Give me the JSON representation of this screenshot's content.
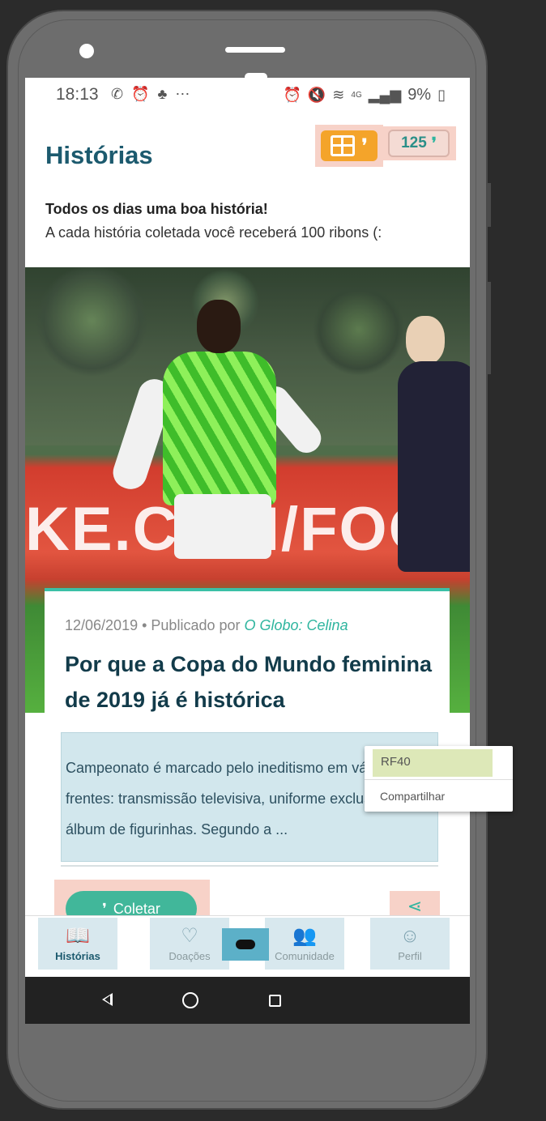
{
  "status_bar": {
    "time": "18:13",
    "left_icons": [
      "whatsapp-icon",
      "alarm-icon",
      "notification-icon",
      "more-icon"
    ],
    "right_icons": [
      "alarm-icon",
      "mute-icon",
      "wifi-icon",
      "signal-icon"
    ],
    "network": "4G",
    "battery": "9%"
  },
  "header": {
    "title": "Histórias",
    "ribbons_count": "125"
  },
  "intro": {
    "headline": "Todos os dias uma boa história!",
    "description": "A cada história coletada você receberá 100 ribons (:"
  },
  "story": {
    "date": "12/06/2019",
    "published_by_label": "• Publicado por",
    "source": "O Globo: Celina",
    "title": "Por que a Copa do Mundo feminina de 2019 já é histórica",
    "excerpt": "Campeonato é marcado pelo ineditismo em várias frentes: transmissão televisiva, uniforme exclusivo e álbum de figurinhas. Segundo a ...",
    "collect_label": "Coletar",
    "image_board_text": "KE.COM/FOO"
  },
  "popup_menu": {
    "items": [
      "RF40",
      "Compartilhar"
    ]
  },
  "bottom_nav": {
    "items": [
      {
        "label": "Histórias",
        "icon": "book-open-icon",
        "active": true
      },
      {
        "label": "Doações",
        "icon": "heart-icon",
        "active": false
      },
      {
        "label": "Comunidade",
        "icon": "people-icon",
        "active": false
      },
      {
        "label": "Perfil",
        "icon": "face-icon",
        "active": false
      }
    ],
    "center_icon": "gamepad-icon"
  },
  "colors": {
    "title": "#1c5a6e",
    "accent": "#41b79a",
    "gift": "#f4a42a",
    "excerpt_bg": "#d2e7ed"
  }
}
